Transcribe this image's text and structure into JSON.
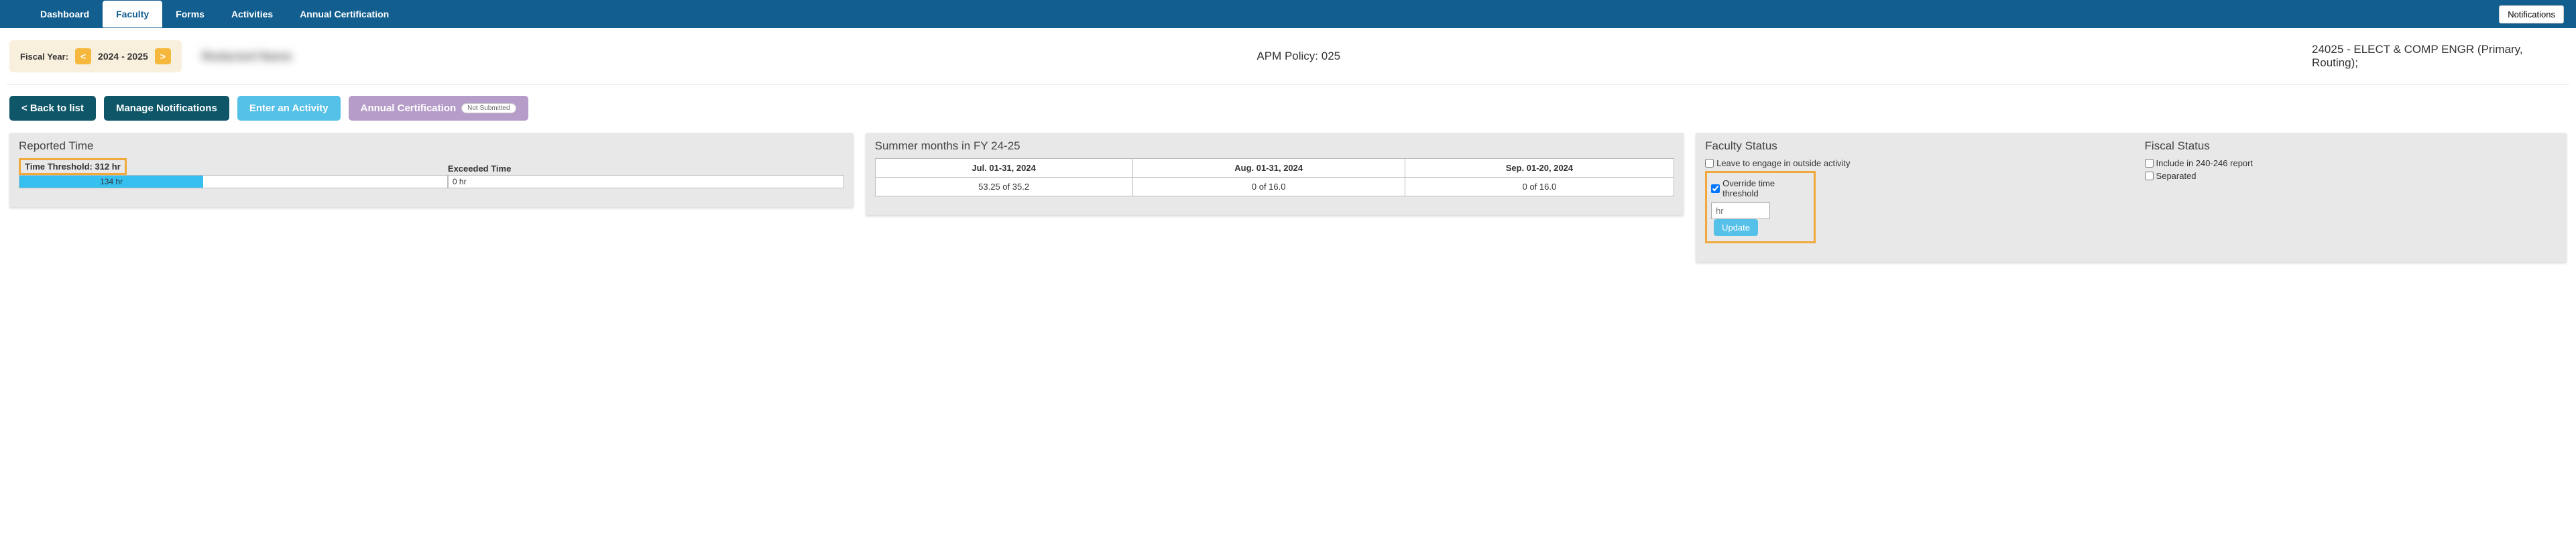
{
  "nav": {
    "tabs": [
      "Dashboard",
      "Faculty",
      "Forms",
      "Activities",
      "Annual Certification"
    ],
    "active": "Faculty",
    "notifications": "Notifications"
  },
  "summary": {
    "fy_label": "Fiscal Year:",
    "prev": "<",
    "next": ">",
    "year": "2024 - 2025",
    "name_blurred": "Redacted Name",
    "policy": "APM Policy: 025",
    "dept": "24025 - ELECT & COMP ENGR (Primary, Routing);"
  },
  "buttons": {
    "back": "< Back to list",
    "manage": "Manage Notifications",
    "enter": "Enter an Activity",
    "annual": "Annual Certification",
    "annual_badge": "Not Submitted"
  },
  "reported": {
    "title": "Reported Time",
    "threshold": "Time Threshold: 312 hr",
    "bar_label": "134 hr",
    "exceeded_label": "Exceeded Time",
    "exceeded_value": "0 hr"
  },
  "summer": {
    "title": "Summer months in FY 24-25",
    "headers": [
      "Jul. 01-31, 2024",
      "Aug. 01-31, 2024",
      "Sep. 01-20, 2024"
    ],
    "values": [
      "53.25 of 35.2",
      "0 of 16.0",
      "0 of 16.0"
    ]
  },
  "faculty_status": {
    "title": "Faculty Status",
    "leave": "Leave to engage in outside activity",
    "override": "Override time threshold",
    "hr_placeholder": "hr",
    "update": "Update"
  },
  "fiscal_status": {
    "title": "Fiscal Status",
    "include": "Include in 240-246 report",
    "separated": "Separated"
  }
}
